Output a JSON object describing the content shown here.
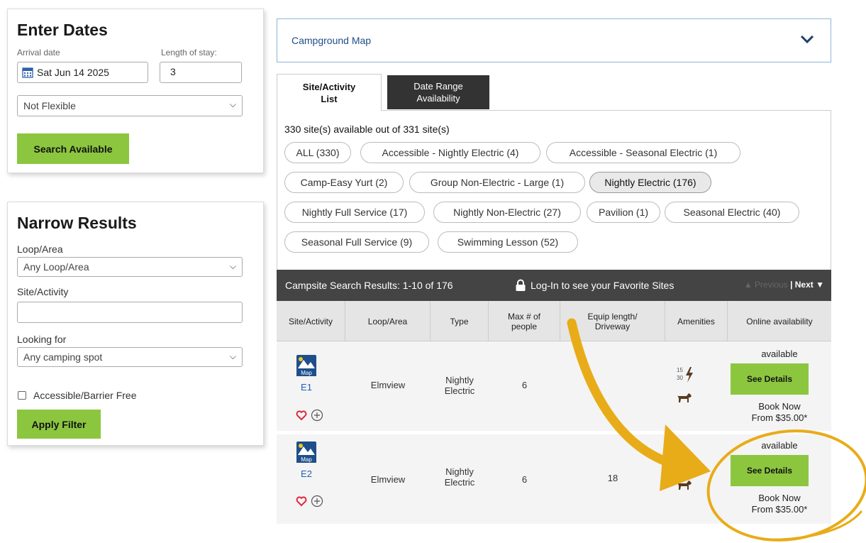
{
  "enter_dates": {
    "title": "Enter Dates",
    "arrival_label": "Arrival date",
    "arrival_value": "Sat Jun 14 2025",
    "stay_label": "Length of stay:",
    "stay_value": "3",
    "flex_value": "Not Flexible",
    "search_label": "Search Available"
  },
  "narrow": {
    "title": "Narrow Results",
    "loop_label": "Loop/Area",
    "loop_value": "Any Loop/Area",
    "site_label": "Site/Activity",
    "site_value": "",
    "looking_label": "Looking for",
    "looking_value": "Any camping spot",
    "accessible_label": "Accessible/Barrier Free",
    "apply_label": "Apply Filter"
  },
  "map": {
    "label": "Campground Map"
  },
  "tabs": [
    {
      "line1": "Site/Activity",
      "line2": "List"
    },
    {
      "line1": "Date Range",
      "line2": "Availability"
    }
  ],
  "availability_text": "330 site(s) available out of 331 site(s)",
  "categories": [
    "ALL (330)",
    "Accessible - Nightly Electric (4)",
    "Accessible - Seasonal Electric (1)",
    "Camp-Easy Yurt (2)",
    "Group Non-Electric - Large (1)",
    "Nightly Electric (176)",
    "Nightly Full Service (17)",
    "Nightly Non-Electric (27)",
    "Pavilion (1)",
    "Seasonal Electric (40)",
    "Seasonal Full Service (9)",
    "Swimming Lesson (52)"
  ],
  "active_category": "Nightly Electric (176)",
  "results": {
    "title": "Campsite Search Results: 1-10 of 176",
    "login_text": "Log-In to see your Favorite Sites",
    "prev_label": "▲ Previous",
    "next_label": "| Next ▼"
  },
  "columns": [
    "Site/Activity",
    "Loop/Area",
    "Type",
    "Max # of people",
    "Equip length/ Driveway",
    "Amenities",
    "Online availability"
  ],
  "rows": [
    {
      "map_label": "Map",
      "site": "E1",
      "loop": "Elmview",
      "type_line1": "Nightly",
      "type_line2": "Electric",
      "max_people": "6",
      "equip_length": "",
      "amp_top": "15",
      "amp_bottom": "30",
      "availability": "available",
      "details_label": "See Details",
      "book_now": "Book Now",
      "price": "From $35.00*"
    },
    {
      "map_label": "Map",
      "site": "E2",
      "loop": "Elmview",
      "type_line1": "Nightly",
      "type_line2": "Electric",
      "max_people": "6",
      "equip_length": "18",
      "amp_top": "",
      "amp_bottom": "",
      "availability": "available",
      "details_label": "See Details",
      "book_now": "Book Now",
      "price": "From $35.00*"
    }
  ],
  "colors": {
    "accent_green": "#8cc63f",
    "dark_header": "#444444",
    "link_blue": "#1f5fb4",
    "heart_red": "#e0283a",
    "annotation_gold": "#e8ac19"
  },
  "icons": [
    "calendar-icon",
    "chevron-down-icon",
    "lock-icon",
    "map-icon",
    "heart-icon",
    "add-circle-icon",
    "electric-icon",
    "pet-icon"
  ]
}
